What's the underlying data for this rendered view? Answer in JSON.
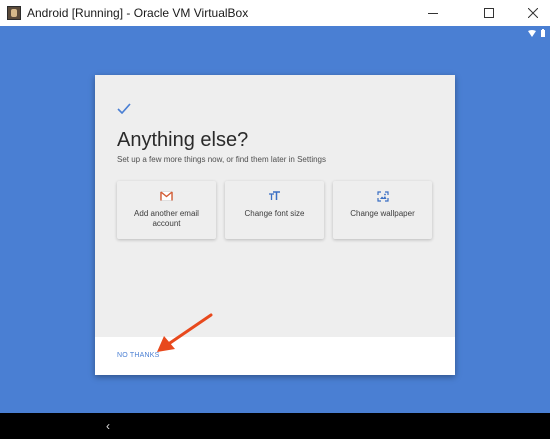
{
  "window": {
    "title": "Android [Running] - Oracle VM VirtualBox",
    "buttons": {
      "minimize": "minimize-icon",
      "maximize": "maximize-icon",
      "close": "close-icon"
    }
  },
  "status_bar": {
    "icons": [
      "wifi-icon",
      "battery-icon"
    ]
  },
  "dialog": {
    "icon": "check-icon",
    "title": "Anything else?",
    "subtitle": "Set up a few more things now, or find them later in Settings",
    "cards": [
      {
        "icon": "gmail-icon",
        "label": "Add another email account"
      },
      {
        "icon": "font-size-icon",
        "label": "Change font size"
      },
      {
        "icon": "wallpaper-icon",
        "label": "Change wallpaper"
      }
    ],
    "footer": {
      "no_thanks": "NO THANKS"
    }
  },
  "navigation": {
    "back": "‹"
  },
  "colors": {
    "screen_background": "#4a7fd3",
    "dialog_background": "#eeeeee",
    "accent": "#4a7fd3",
    "annotation_arrow": "#e8491d",
    "nav_bar": "#000000"
  }
}
